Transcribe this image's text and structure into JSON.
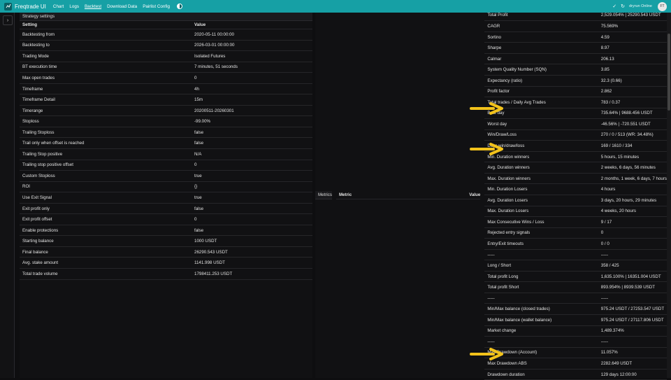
{
  "app": {
    "title": "Freqtrade UI"
  },
  "nav": {
    "items": [
      "Chart",
      "Logs",
      "Backtest",
      "Download Data",
      "Pairlist Config"
    ],
    "active": "Backtest"
  },
  "status": {
    "label": "dryrun Online",
    "avatar": "FT"
  },
  "strategy_settings": {
    "title": "Strategy settings",
    "headers": [
      "Setting",
      "Value"
    ],
    "rows": [
      [
        "Backtesting from",
        "2020-05-11 00:00:00"
      ],
      [
        "Backtesting to",
        "2026-03-01 00:00:00"
      ],
      [
        "Trading Mode",
        "Isolated Futures"
      ],
      [
        "BT execution time",
        "7 minutes, 51 seconds"
      ],
      [
        "Max open trades",
        "0"
      ],
      [
        "Timeframe",
        "4h"
      ],
      [
        "Timeframe Detail",
        "15m"
      ],
      [
        "Timerange",
        "20200511-20260301"
      ],
      [
        "Stoploss",
        "-99.00%"
      ],
      [
        "Trailing Stoploss",
        "false"
      ],
      [
        "Trail only when offset is reached",
        "false"
      ],
      [
        "Trailing Stop positive",
        "N/A"
      ],
      [
        "Trailing stop positive offset",
        "0"
      ],
      [
        "Custom Stoploss",
        "true"
      ],
      [
        "ROI",
        "{}"
      ],
      [
        "Use Exit Signal",
        "true"
      ],
      [
        "Exit profit only",
        "false"
      ],
      [
        "Exit profit offset",
        "0"
      ],
      [
        "Enable protections",
        "false"
      ],
      [
        "Starting balance",
        "1000 USDT"
      ],
      [
        "Final balance",
        "26290.543 USDT"
      ],
      [
        "Avg. stake amount",
        "1141.998 USDT"
      ],
      [
        "Total trade volume",
        "1798411.253 USDT"
      ]
    ]
  },
  "metrics": {
    "title": "Metrics",
    "headers": [
      "Metric",
      "Value"
    ],
    "rows": [
      [
        "Total Profit",
        "2,529.054% | 25290.543 USDT"
      ],
      [
        "CAGR",
        "75.569%"
      ],
      [
        "Sortino",
        "4.59"
      ],
      [
        "Sharpe",
        "8.97"
      ],
      [
        "Calmar",
        "206.13"
      ],
      [
        "System Quality Number (SQN)",
        "3.85"
      ],
      [
        "Expectancy (ratio)",
        "32.3 (0.66)"
      ],
      [
        "Profit factor",
        "2.862"
      ],
      [
        "Total trades / Daily Avg Trades",
        "783 / 0.37"
      ],
      [
        "Best day",
        "735.64% | 9688.456 USDT"
      ],
      [
        "Worst day",
        "-46.56% | -720.551 USDT"
      ],
      [
        "Win/Draw/Loss",
        "270 / 0 / 513 (WR: 34.48%)"
      ],
      [
        "Days win/draw/loss",
        "169 / 1610 / 334"
      ],
      [
        "Min. Duration winners",
        "5 hours, 15 minutes"
      ],
      [
        "Avg. Duration winners",
        "2 weeks, 6 days, 56 minutes"
      ],
      [
        "Max. Duration winners",
        "2 months, 1 week, 6 days, 7 hours"
      ],
      [
        "Min. Duration Losers",
        "4 hours"
      ],
      [
        "Avg. Duration Losers",
        "3 days, 20 hours, 29 minutes"
      ],
      [
        "Max. Duration Losers",
        "4 weeks, 20 hours"
      ],
      [
        "Max Consecutive Wins / Loss",
        "9 / 17"
      ],
      [
        "Rejected entry signals",
        "0"
      ],
      [
        "Entry/Exit timeouts",
        "0 / 0"
      ],
      [
        "-----",
        "-----"
      ],
      [
        "Long / Short",
        "358 / 425"
      ],
      [
        "Total profit Long",
        "1,635.100% | 16351.004 USDT"
      ],
      [
        "Total profit Short",
        "893.954% | 8939.539 USDT"
      ],
      [
        "-----",
        "-----"
      ],
      [
        "Min/Max balance (closed trades)",
        "975.24 USDT / 27253.547 USDT"
      ],
      [
        "Min/Max balance (wallet balance)",
        "975.24 USDT / 27117.806 USDT"
      ],
      [
        "Market change",
        "1,489.374%"
      ],
      [
        "-----",
        "-----"
      ],
      [
        "Max Drawdown (Account)",
        "11.057%"
      ],
      [
        "Max Drawdown ABS",
        "2282.649 USDT"
      ],
      [
        "Drawdown duration",
        "129 days 12:00:00"
      ]
    ]
  },
  "colors": {
    "topbar": "#16a0a5",
    "arrow": "#f2c21b"
  }
}
